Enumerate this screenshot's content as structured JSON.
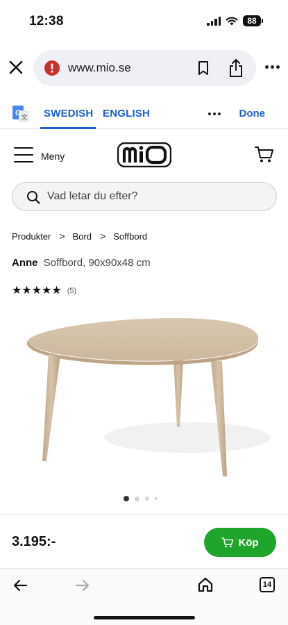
{
  "status": {
    "time": "12:38",
    "battery": "88"
  },
  "browser": {
    "url": "www.mio.se",
    "translate": {
      "lang_source": "SWEDISH",
      "lang_target": "ENGLISH",
      "done_label": "Done"
    },
    "tab_count": "14"
  },
  "site": {
    "menu_label": "Meny",
    "logo_text": "miO",
    "search_placeholder": "Vad letar du efter?",
    "breadcrumb": [
      "Produkter",
      "Bord",
      "Soffbord"
    ],
    "breadcrumb_separator": ">"
  },
  "product": {
    "name": "Anne",
    "description": "Soffbord, 90x90x48 cm",
    "rating_stars": "★★★★★",
    "rating_value": 5,
    "review_count": "(5)",
    "image_count": 4,
    "active_image": 0,
    "price": "3.195:-",
    "buy_label": "Köp"
  },
  "colors": {
    "accent_blue": "#1a5fcf",
    "buy_green": "#1fa52b",
    "table_wood": "#cdb9a0"
  },
  "icons": {
    "close": "close-icon",
    "site_security": "warning-icon",
    "bookmark": "bookmark-icon",
    "share": "share-icon",
    "translate": "google-translate-icon",
    "menu": "hamburger-icon",
    "cart": "cart-icon",
    "search": "search-icon",
    "back": "back-arrow-icon",
    "forward": "forward-arrow-icon",
    "home": "home-icon"
  }
}
